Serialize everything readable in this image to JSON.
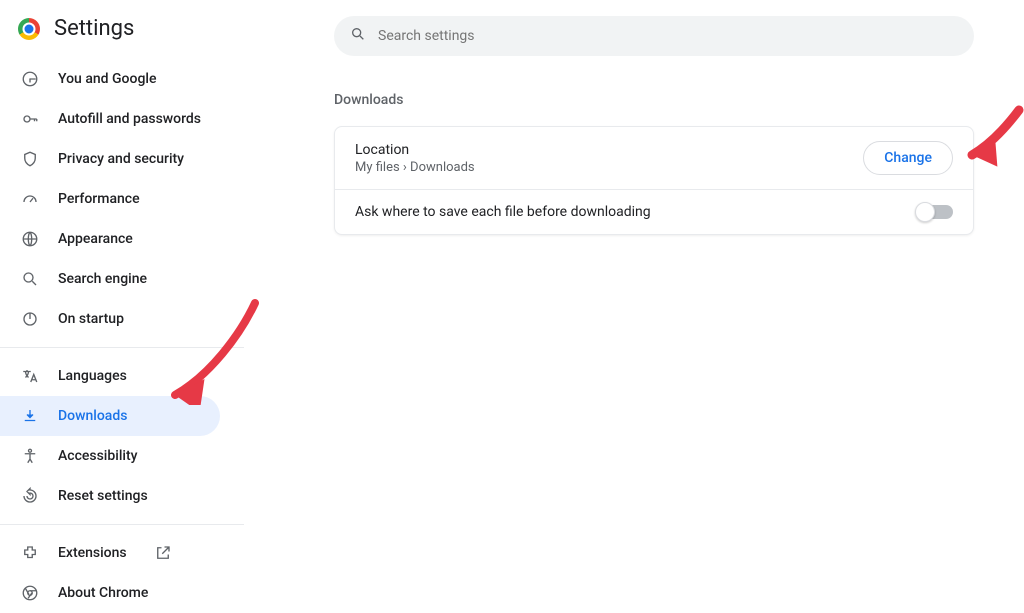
{
  "header": {
    "title": "Settings"
  },
  "search": {
    "placeholder": "Search settings"
  },
  "sidebar": {
    "items": [
      {
        "label": "You and Google"
      },
      {
        "label": "Autofill and passwords"
      },
      {
        "label": "Privacy and security"
      },
      {
        "label": "Performance"
      },
      {
        "label": "Appearance"
      },
      {
        "label": "Search engine"
      },
      {
        "label": "On startup"
      },
      {
        "label": "Languages"
      },
      {
        "label": "Downloads"
      },
      {
        "label": "Accessibility"
      },
      {
        "label": "Reset settings"
      },
      {
        "label": "Extensions"
      },
      {
        "label": "About Chrome"
      }
    ]
  },
  "main": {
    "section_title": "Downloads",
    "location_label": "Location",
    "location_path": "My files › Downloads",
    "change_button": "Change",
    "ask_where_label": "Ask where to save each file before downloading",
    "ask_where_toggle_on": false
  },
  "colors": {
    "accent": "#1a73e8",
    "annotation": "#e63946"
  }
}
